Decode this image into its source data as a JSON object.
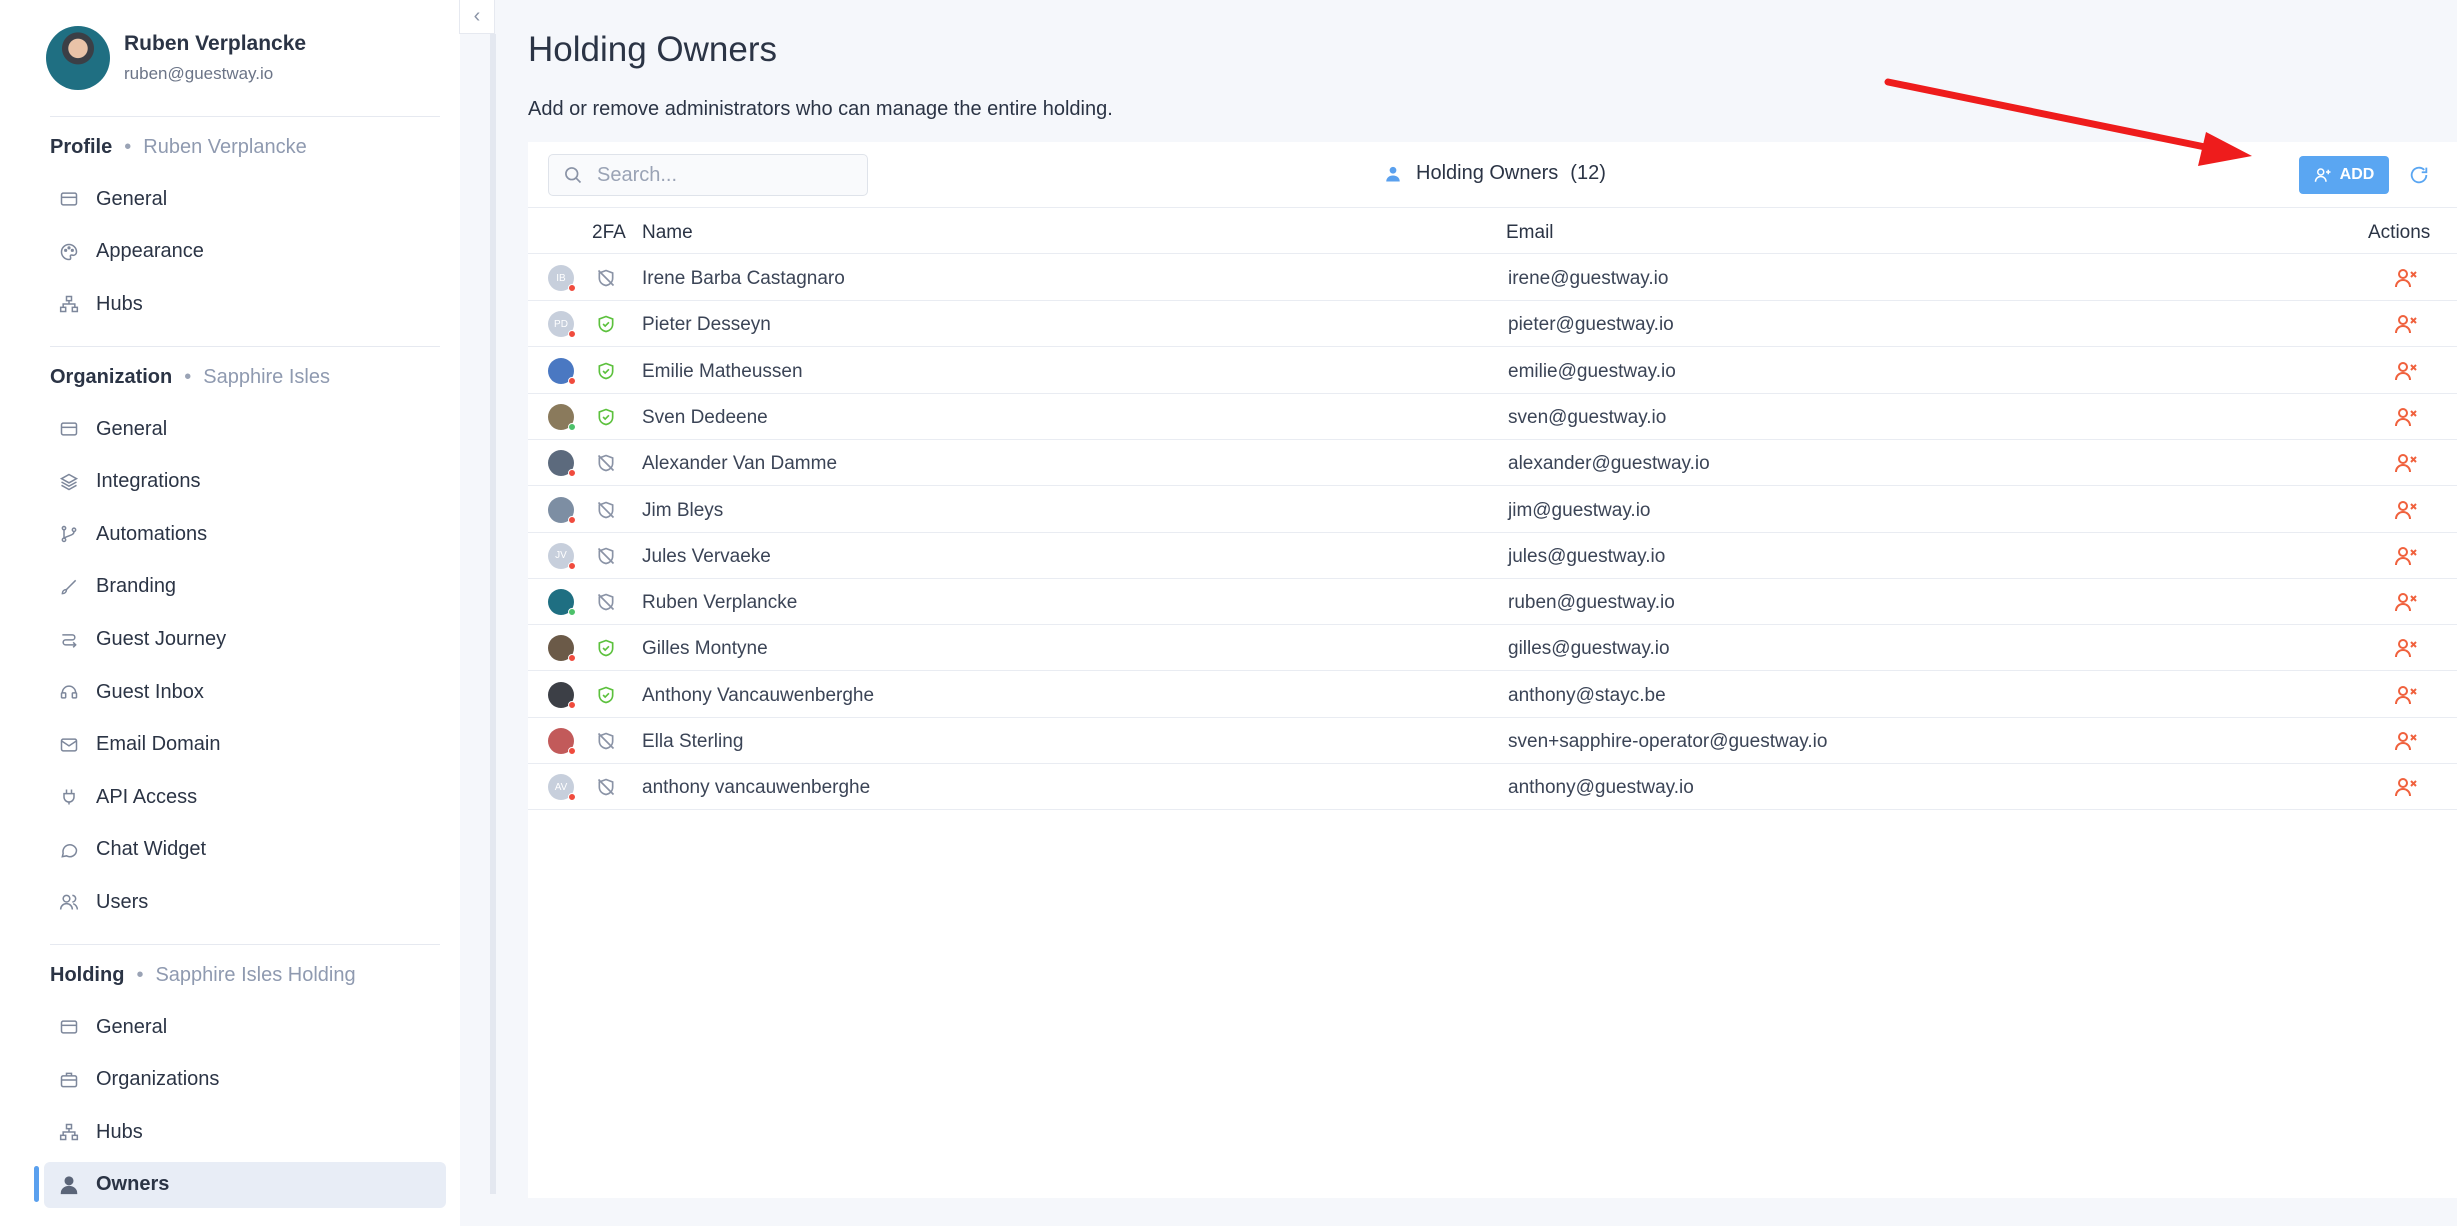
{
  "profile": {
    "name": "Ruben Verplancke",
    "email": "ruben@guestway.io"
  },
  "sections": [
    {
      "title": "Profile",
      "sub": "Ruben Verplancke",
      "items": [
        {
          "label": "General",
          "icon": "card"
        },
        {
          "label": "Appearance",
          "icon": "palette"
        },
        {
          "label": "Hubs",
          "icon": "hierarchy"
        }
      ]
    },
    {
      "title": "Organization",
      "sub": "Sapphire Isles",
      "items": [
        {
          "label": "General",
          "icon": "card"
        },
        {
          "label": "Integrations",
          "icon": "layers"
        },
        {
          "label": "Automations",
          "icon": "branch"
        },
        {
          "label": "Branding",
          "icon": "brush"
        },
        {
          "label": "Guest Journey",
          "icon": "route"
        },
        {
          "label": "Guest Inbox",
          "icon": "inbox"
        },
        {
          "label": "Email Domain",
          "icon": "mail"
        },
        {
          "label": "API Access",
          "icon": "plug"
        },
        {
          "label": "Chat Widget",
          "icon": "chat"
        },
        {
          "label": "Users",
          "icon": "users"
        }
      ]
    },
    {
      "title": "Holding",
      "sub": "Sapphire Isles Holding",
      "items": [
        {
          "label": "General",
          "icon": "card"
        },
        {
          "label": "Organizations",
          "icon": "briefcase"
        },
        {
          "label": "Hubs",
          "icon": "hierarchy"
        },
        {
          "label": "Owners",
          "icon": "user"
        }
      ]
    }
  ],
  "page": {
    "title": "Holding Owners",
    "description": "Add or remove administrators who can manage the entire holding."
  },
  "toolbar": {
    "search_placeholder": "Search...",
    "heading": "Holding Owners",
    "count": "(12)",
    "add_label": "ADD"
  },
  "table": {
    "columns": {
      "twofa": "2FA",
      "name": "Name",
      "email": "Email",
      "actions": "Actions"
    },
    "rows": [
      {
        "initials": "IB",
        "avatar": "#c7cfdc",
        "status": "#f04b3d",
        "twofa": false,
        "name": "Irene Barba Castagnaro",
        "email": "irene@guestway.io"
      },
      {
        "initials": "PD",
        "avatar": "#c7cfdc",
        "status": "#f04b3d",
        "twofa": true,
        "name": "Pieter Desseyn",
        "email": "pieter@guestway.io"
      },
      {
        "initials": "",
        "avatar": "#4a78c2",
        "status": "#f04b3d",
        "twofa": true,
        "name": "Emilie Matheussen",
        "email": "emilie@guestway.io"
      },
      {
        "initials": "",
        "avatar": "#8a7a5c",
        "status": "#4cc16a",
        "twofa": true,
        "name": "Sven Dedeene",
        "email": "sven@guestway.io"
      },
      {
        "initials": "",
        "avatar": "#5c6a7d",
        "status": "#f04b3d",
        "twofa": false,
        "name": "Alexander Van Damme",
        "email": "alexander@guestway.io"
      },
      {
        "initials": "",
        "avatar": "#7d8ea3",
        "status": "#f04b3d",
        "twofa": false,
        "name": "Jim Bleys",
        "email": "jim@guestway.io"
      },
      {
        "initials": "JV",
        "avatar": "#c7cfdc",
        "status": "#f04b3d",
        "twofa": false,
        "name": "Jules Vervaeke",
        "email": "jules@guestway.io"
      },
      {
        "initials": "",
        "avatar": "#1f6f82",
        "status": "#4cc16a",
        "twofa": false,
        "name": "Ruben Verplancke",
        "email": "ruben@guestway.io"
      },
      {
        "initials": "",
        "avatar": "#6b5a48",
        "status": "#f04b3d",
        "twofa": true,
        "name": "Gilles Montyne",
        "email": "gilles@guestway.io"
      },
      {
        "initials": "",
        "avatar": "#3c3f46",
        "status": "#f04b3d",
        "twofa": true,
        "name": "Anthony Vancauwenberghe",
        "email": "anthony@stayc.be"
      },
      {
        "initials": "",
        "avatar": "#c25a5a",
        "status": "#f04b3d",
        "twofa": false,
        "name": "Ella Sterling",
        "email": "sven+sapphire-operator@guestway.io"
      },
      {
        "initials": "AV",
        "avatar": "#c7cfdc",
        "status": "#f04b3d",
        "twofa": false,
        "name": "anthony vancauwenberghe",
        "email": "anthony@guestway.io"
      }
    ]
  },
  "colors": {
    "accent": "#5aa6f2",
    "danger": "#f0613d",
    "shield_on": "#5cc13d",
    "shield_off": "#8a93a6",
    "annotation": "#ee1c1c"
  }
}
